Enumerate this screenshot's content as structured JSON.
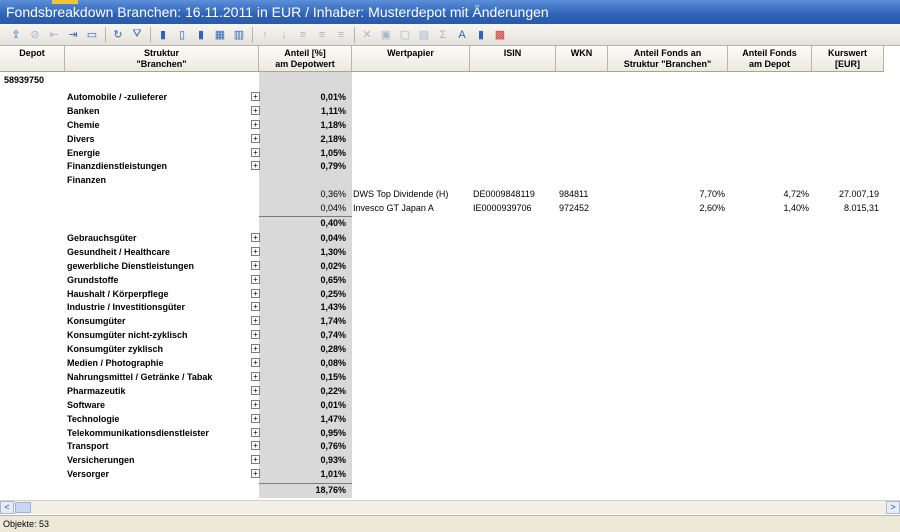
{
  "window": {
    "title": "Fondsbreakdown Branchen: 16.11.2011 in EUR / Inhaber: Musterdepot mit Änderungen"
  },
  "toolbar": {
    "icons": [
      "export-icon",
      "filter-off-icon",
      "collapse-icon",
      "expand-icon",
      "column-icon",
      "refresh-icon",
      "funnel-icon",
      "bar-chart-icon",
      "bar-chart-2-icon",
      "bar-chart-3-icon",
      "pivot-icon",
      "table-icon",
      "sort-asc-icon",
      "sort-desc-icon",
      "align-left-icon",
      "align-center-icon",
      "align-right-icon",
      "delete-icon",
      "group-icon",
      "ungroup-icon",
      "columns-icon",
      "sum-icon",
      "font-icon",
      "chart-bar-icon",
      "chart-color-icon"
    ]
  },
  "columns": [
    {
      "line1": "Depot",
      "line2": ""
    },
    {
      "line1": "Struktur",
      "line2": "\"Branchen\""
    },
    {
      "line1": "Anteil [%]",
      "line2": "am Depotwert"
    },
    {
      "line1": "Wertpapier",
      "line2": ""
    },
    {
      "line1": "ISIN",
      "line2": ""
    },
    {
      "line1": "WKN",
      "line2": ""
    },
    {
      "line1": "Anteil Fonds an",
      "line2": "Struktur \"Branchen\""
    },
    {
      "line1": "Anteil Fonds",
      "line2": "am Depot"
    },
    {
      "line1": "Kurswert",
      "line2": "[EUR]"
    }
  ],
  "depot": "58939750",
  "branches_top": [
    {
      "name": "Automobile / -zulieferer",
      "anteil": "0,01%"
    },
    {
      "name": "Banken",
      "anteil": "1,11%"
    },
    {
      "name": "Chemie",
      "anteil": "1,18%"
    },
    {
      "name": "Divers",
      "anteil": "2,18%"
    },
    {
      "name": "Energie",
      "anteil": "1,05%"
    },
    {
      "name": "Finanzdienstleistungen",
      "anteil": "0,79%"
    }
  ],
  "finanzen": {
    "name": "Finanzen",
    "subtotal": "0,40%",
    "rows": [
      {
        "anteil": "0,36%",
        "wertpapier": "DWS Top Dividende (H)",
        "isin": "DE0009848119",
        "wkn": "984811",
        "anteil_struktur": "7,70%",
        "anteil_depot": "4,72%",
        "kurswert": "27.007,19"
      },
      {
        "anteil": "0,04%",
        "wertpapier": "Invesco GT Japan A",
        "isin": "IE0000939706",
        "wkn": "972452",
        "anteil_struktur": "2,60%",
        "anteil_depot": "1,40%",
        "kurswert": "8.015,31"
      }
    ]
  },
  "branches_bottom": [
    {
      "name": "Gebrauchsgüter",
      "anteil": "0,04%"
    },
    {
      "name": "Gesundheit / Healthcare",
      "anteil": "1,30%"
    },
    {
      "name": "gewerbliche Dienstleistungen",
      "anteil": "0,02%"
    },
    {
      "name": "Grundstoffe",
      "anteil": "0,65%"
    },
    {
      "name": "Haushalt / Körperpflege",
      "anteil": "0,25%"
    },
    {
      "name": "Industrie / Investitionsgüter",
      "anteil": "1,43%"
    },
    {
      "name": "Konsumgüter",
      "anteil": "1,74%"
    },
    {
      "name": "Konsumgüter nicht-zyklisch",
      "anteil": "0,74%"
    },
    {
      "name": "Konsumgüter zyklisch",
      "anteil": "0,28%"
    },
    {
      "name": "Medien / Photographie",
      "anteil": "0,08%"
    },
    {
      "name": "Nahrungsmittel / Getränke / Tabak",
      "anteil": "0,15%"
    },
    {
      "name": "Pharmazeutik",
      "anteil": "0,22%"
    },
    {
      "name": "Software",
      "anteil": "0,01%"
    },
    {
      "name": "Technologie",
      "anteil": "1,47%"
    },
    {
      "name": "Telekommunikationsdienstleister",
      "anteil": "0,95%"
    },
    {
      "name": "Transport",
      "anteil": "0,76%"
    },
    {
      "name": "Versicherungen",
      "anteil": "0,93%"
    },
    {
      "name": "Versorger",
      "anteil": "1,01%"
    }
  ],
  "total": "18,76%",
  "scroll": {
    "left": "<",
    "right": ">"
  },
  "status": {
    "text": "Objekte: 53"
  }
}
